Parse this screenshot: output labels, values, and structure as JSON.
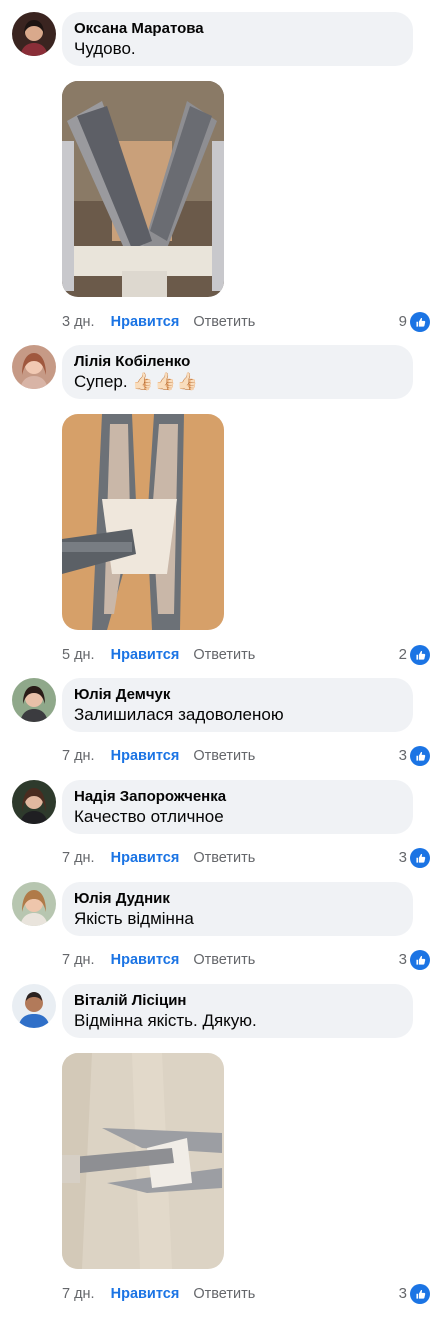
{
  "like_label": "Нравится",
  "reply_label": "Ответить",
  "accent_color": "#1b74e4",
  "comments": [
    {
      "author": "Оксана Маратова",
      "text": "Чудово.",
      "time": "3 дн.",
      "reactions": "9",
      "has_photo": true
    },
    {
      "author": "Лілія Кобіленко",
      "text": "Супер.",
      "emoji": "👍🏻👍🏻👍🏻",
      "time": "5 дн.",
      "reactions": "2",
      "has_photo": true
    },
    {
      "author": "Юлія Демчук",
      "text": "Залишилася задоволеною",
      "time": "7 дн.",
      "reactions": "3",
      "has_photo": false
    },
    {
      "author": "Надія Запорожченка",
      "text": "Качество отличное",
      "time": "7 дн.",
      "reactions": "3",
      "has_photo": false
    },
    {
      "author": "Юлія Дудник",
      "text": "Якість відмінна",
      "time": "7 дн.",
      "reactions": "3",
      "has_photo": false
    },
    {
      "author": "Віталій Лісіцин",
      "text": "Відмінна якість. Дякую.",
      "time": "7 дн.",
      "reactions": "3",
      "has_photo": true
    }
  ]
}
